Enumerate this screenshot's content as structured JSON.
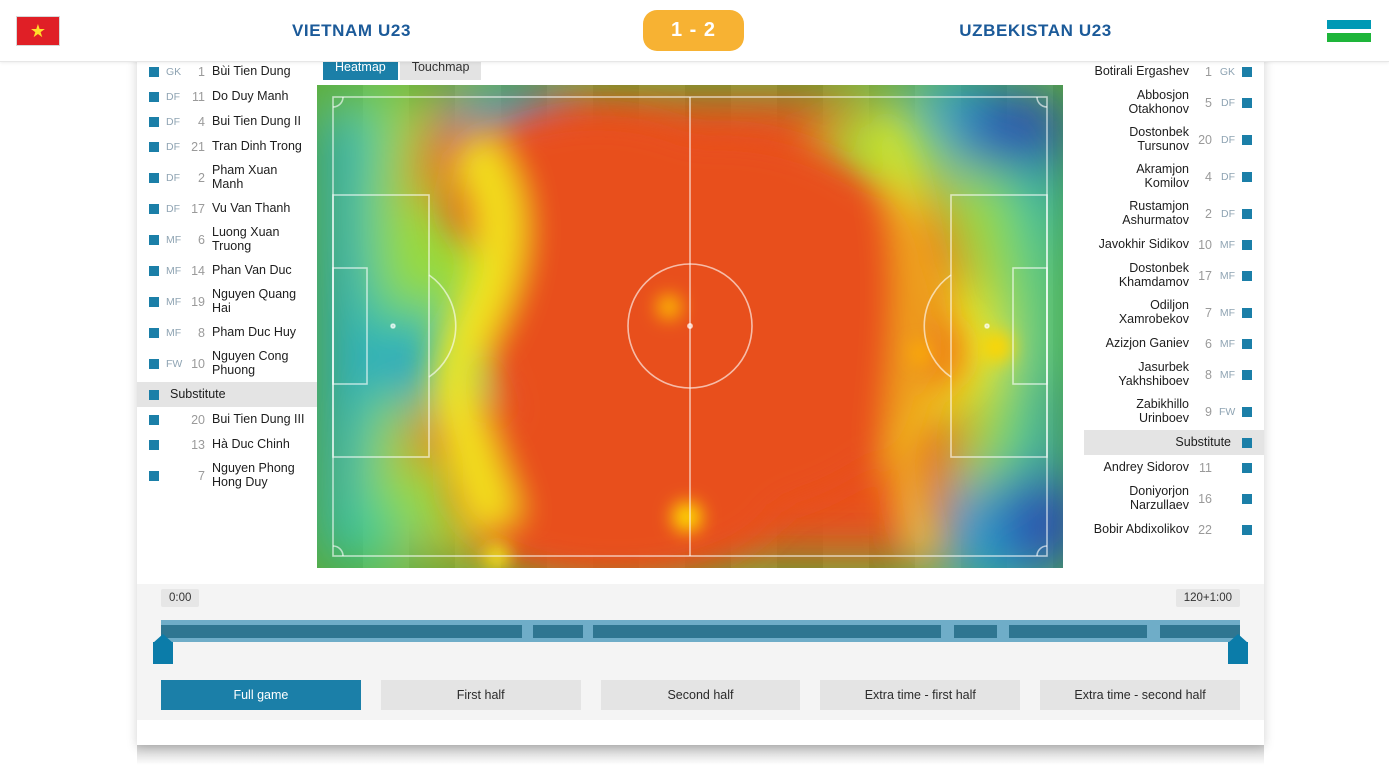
{
  "header": {
    "home_team": "VIETNAM U23",
    "away_team": "UZBEKISTAN U23",
    "score": "1 - 2",
    "home_flag_icon": "vietnam-flag-icon",
    "away_flag_icon": "uzbekistan-flag-icon",
    "accent_color": "#1b5a99",
    "score_color": "#f7b233"
  },
  "tabs": [
    {
      "label": "Heatmap",
      "active": true
    },
    {
      "label": "Touchmap",
      "active": false
    }
  ],
  "home_roster": {
    "starters": [
      {
        "pos": "GK",
        "num": "1",
        "name": "Bùi Tien Dung"
      },
      {
        "pos": "DF",
        "num": "11",
        "name": "Do Duy Manh"
      },
      {
        "pos": "DF",
        "num": "4",
        "name": "Bui Tien Dung II"
      },
      {
        "pos": "DF",
        "num": "21",
        "name": "Tran Dinh Trong"
      },
      {
        "pos": "DF",
        "num": "2",
        "name": "Pham Xuan Manh"
      },
      {
        "pos": "DF",
        "num": "17",
        "name": "Vu Van Thanh"
      },
      {
        "pos": "MF",
        "num": "6",
        "name": "Luong Xuan Truong"
      },
      {
        "pos": "MF",
        "num": "14",
        "name": "Phan Van Duc"
      },
      {
        "pos": "MF",
        "num": "19",
        "name": "Nguyen Quang Hai"
      },
      {
        "pos": "MF",
        "num": "8",
        "name": "Pham Duc Huy"
      },
      {
        "pos": "FW",
        "num": "10",
        "name": "Nguyen Cong Phuong"
      }
    ],
    "substitute_label": "Substitute",
    "substitutes": [
      {
        "pos": "",
        "num": "20",
        "name": "Bui Tien Dung III"
      },
      {
        "pos": "",
        "num": "13",
        "name": "Hà Duc Chinh"
      },
      {
        "pos": "",
        "num": "7",
        "name": "Nguyen Phong Hong Duy"
      }
    ]
  },
  "away_roster": {
    "starters": [
      {
        "pos": "GK",
        "num": "1",
        "name": "Botirali Ergashev"
      },
      {
        "pos": "DF",
        "num": "5",
        "name": "Abbosjon Otakhonov"
      },
      {
        "pos": "DF",
        "num": "20",
        "name": "Dostonbek Tursunov"
      },
      {
        "pos": "DF",
        "num": "4",
        "name": "Akramjon Komilov"
      },
      {
        "pos": "DF",
        "num": "2",
        "name": "Rustamjon Ashurmatov"
      },
      {
        "pos": "MF",
        "num": "10",
        "name": "Javokhir Sidikov"
      },
      {
        "pos": "MF",
        "num": "17",
        "name": "Dostonbek Khamdamov"
      },
      {
        "pos": "MF",
        "num": "7",
        "name": "Odiljon Xamrobekov"
      },
      {
        "pos": "MF",
        "num": "6",
        "name": "Azizjon Ganiev"
      },
      {
        "pos": "MF",
        "num": "8",
        "name": "Jasurbek Yakhshiboev"
      },
      {
        "pos": "FW",
        "num": "9",
        "name": "Zabikhillo Urinboev"
      }
    ],
    "substitute_label": "Substitute",
    "substitutes": [
      {
        "pos": "",
        "num": "11",
        "name": "Andrey Sidorov"
      },
      {
        "pos": "",
        "num": "16",
        "name": "Doniyorjon Narzullaev"
      },
      {
        "pos": "",
        "num": "22",
        "name": "Bobir Abdixolikov"
      }
    ]
  },
  "timeline": {
    "start_label": "0:00",
    "end_label": "120+1:00",
    "track_color": "#6fadc8",
    "segment_color": "#2f7691",
    "handle_color": "#0b7ca9",
    "segments": [
      {
        "left_pct": 0.0,
        "width_pct": 33.5
      },
      {
        "left_pct": 34.5,
        "width_pct": 4.6
      },
      {
        "left_pct": 40.0,
        "width_pct": 32.3
      },
      {
        "left_pct": 73.5,
        "width_pct": 4.0
      },
      {
        "left_pct": 78.6,
        "width_pct": 12.8
      },
      {
        "left_pct": 92.6,
        "width_pct": 7.4
      }
    ]
  },
  "period_buttons": [
    {
      "label": "Full game",
      "active": true
    },
    {
      "label": "First half",
      "active": false
    },
    {
      "label": "Second half",
      "active": false
    },
    {
      "label": "Extra time - first half",
      "active": false
    },
    {
      "label": "Extra time - second half",
      "active": false
    }
  ],
  "heatmap": {
    "pitch_stripe_colors": [
      "#5aac38",
      "#68b945"
    ],
    "line_color": "rgba(255,255,255,0.72)",
    "scale": [
      "#2a4fb0",
      "#2aa0c8",
      "#3ecf8e",
      "#9ad93a",
      "#f2e81e",
      "#f5a623",
      "#e8501a"
    ]
  }
}
